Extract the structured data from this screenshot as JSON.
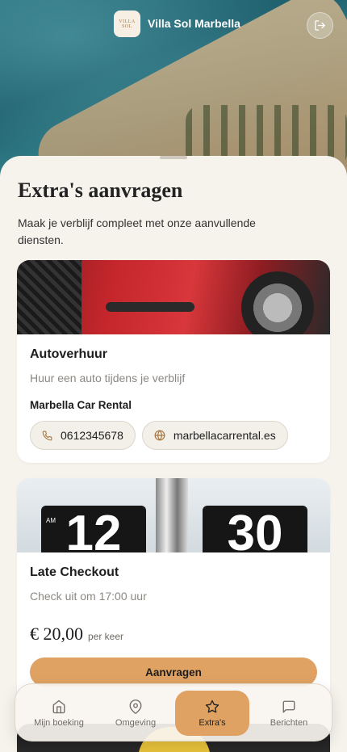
{
  "header": {
    "logo_text": "VILLA SOL",
    "title": "Villa Sol Marbella",
    "logout_icon": "logout-icon"
  },
  "page": {
    "title": "Extra's aanvragen",
    "subtitle": "Maak je verblijf compleet met onze aanvullende diensten."
  },
  "services": [
    {
      "title": "Autoverhuur",
      "description": "Huur een auto tijdens je verblijf",
      "provider": "Marbella Car Rental",
      "phone": "0612345678",
      "website": "marbellacarrental.es"
    },
    {
      "title": "Late Checkout",
      "description": "Check uit om 17:00 uur",
      "price": "€ 20,00",
      "price_unit": "per keer",
      "button_label": "Aanvragen",
      "clock_hour": "12",
      "clock_minute": "30",
      "clock_am": "AM"
    }
  ],
  "nav": {
    "items": [
      {
        "label": "Mijn boeking",
        "icon": "home-icon"
      },
      {
        "label": "Omgeving",
        "icon": "map-pin-icon"
      },
      {
        "label": "Extra's",
        "icon": "star-icon",
        "active": true
      },
      {
        "label": "Berichten",
        "icon": "message-icon"
      }
    ]
  },
  "colors": {
    "accent": "#dfa263",
    "background": "#f6f2ec"
  }
}
